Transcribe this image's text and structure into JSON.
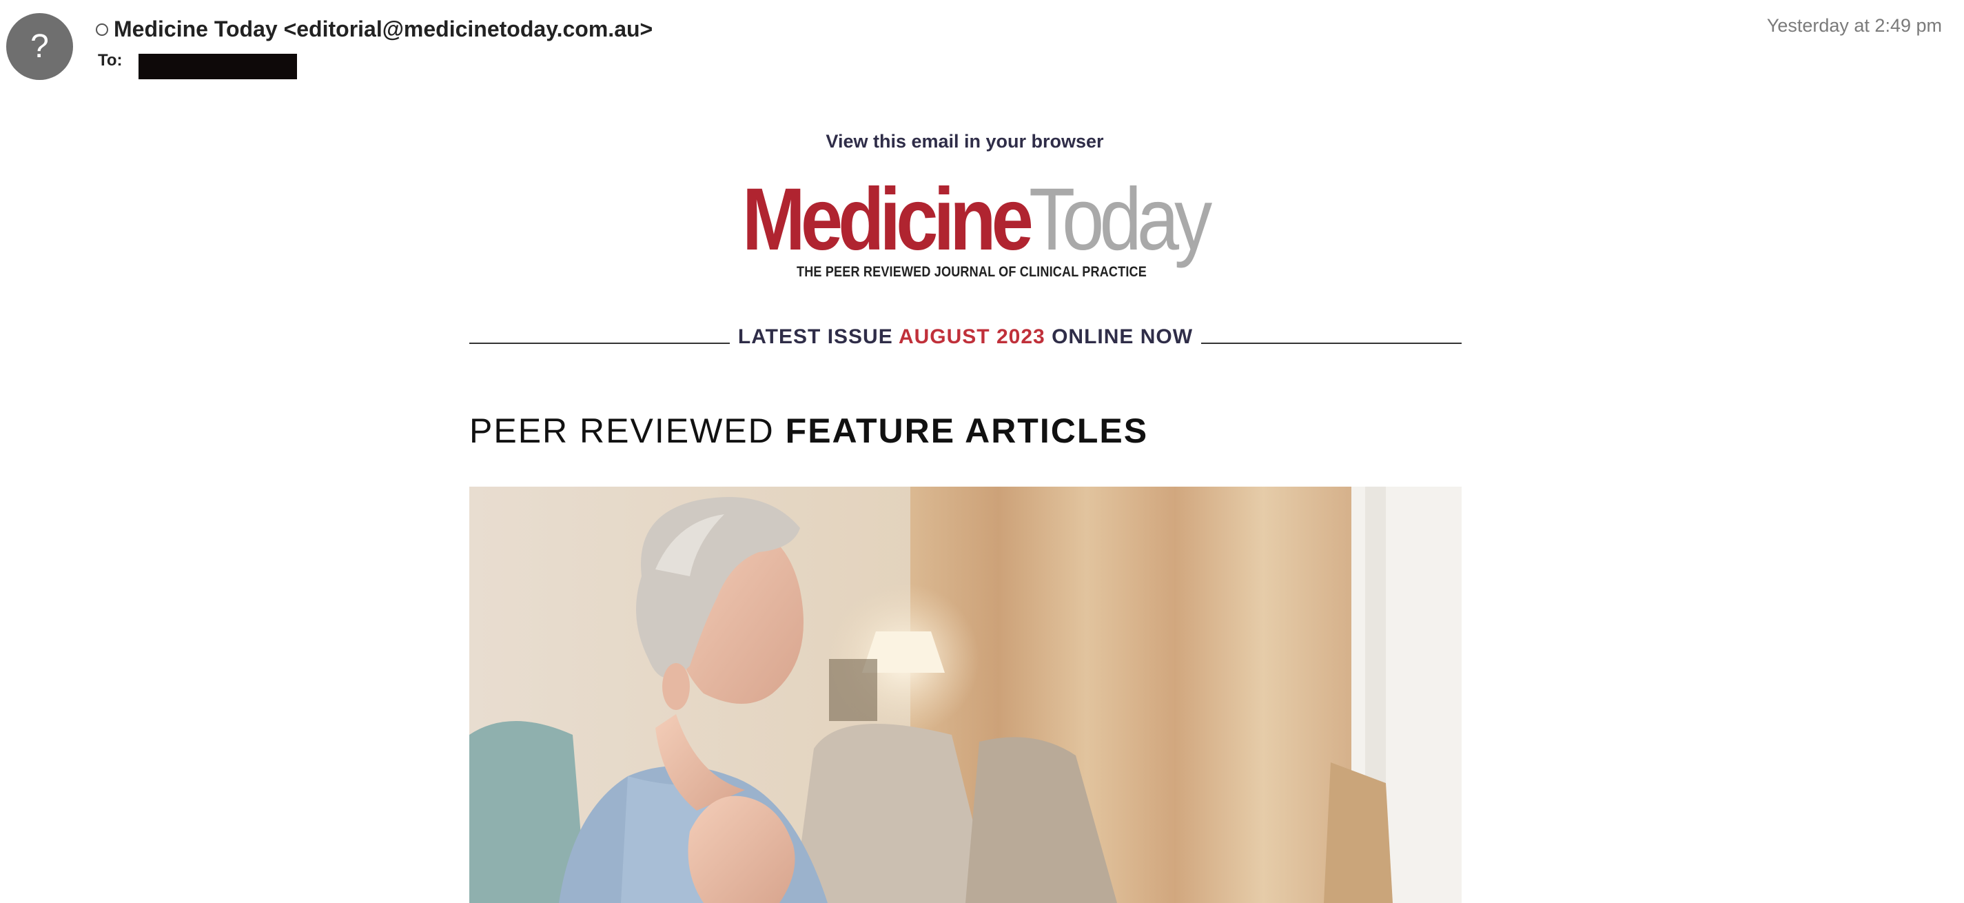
{
  "email": {
    "avatar_glyph": "?",
    "sender": "Medicine Today <editorial@medicinetoday.com.au>",
    "to_label": "To:",
    "timestamp": "Yesterday at 2:49 pm"
  },
  "content": {
    "view_in_browser": "View this email in your browser",
    "logo": {
      "part1": "Medicine",
      "part2": "Today",
      "tagline": "THE PEER REVIEWED JOURNAL OF CLINICAL PRACTICE"
    },
    "issue_banner": {
      "prefix": "LATEST ISSUE",
      "highlight": "AUGUST 2023",
      "suffix": "ONLINE NOW"
    },
    "section_title": {
      "light": "PEER REVIEWED",
      "bold": "FEATURE ARTICLES"
    },
    "hero_image": "woman-holding-chest-photo"
  },
  "colors": {
    "brand_red": "#b02430",
    "logo_grey": "#a9a9a9",
    "navy_text": "#2f2d48"
  }
}
